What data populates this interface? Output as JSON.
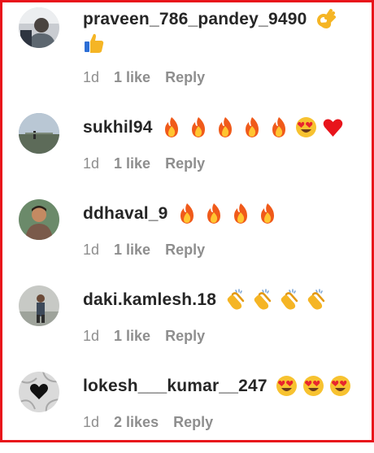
{
  "comments": [
    {
      "username": "praveen_786_pandey_9490",
      "emojis": [
        "ok-hand-icon",
        "thumbs-up-icon"
      ],
      "time": "1d",
      "likes": "1 like",
      "reply": "Reply"
    },
    {
      "username": "sukhil94",
      "emojis": [
        "fire-icon",
        "fire-icon",
        "fire-icon",
        "fire-icon",
        "fire-icon",
        "heart-eyes-icon",
        "red-heart-icon"
      ],
      "time": "1d",
      "likes": "1 like",
      "reply": "Reply"
    },
    {
      "username": "ddhaval_9",
      "emojis": [
        "fire-icon",
        "fire-icon",
        "fire-icon",
        "fire-icon"
      ],
      "time": "1d",
      "likes": "1 like",
      "reply": "Reply"
    },
    {
      "username": "daki.kamlesh.18",
      "emojis": [
        "clapping-hands-icon",
        "clapping-hands-icon",
        "clapping-hands-icon",
        "clapping-hands-icon"
      ],
      "time": "1d",
      "likes": "1 like",
      "reply": "Reply"
    },
    {
      "username": "lokesh___kumar__247",
      "emojis": [
        "heart-eyes-icon",
        "heart-eyes-icon",
        "heart-eyes-icon"
      ],
      "time": "1d",
      "likes": "2 likes",
      "reply": "Reply"
    }
  ],
  "colors": {
    "border": "#e8141b",
    "username": "#262626",
    "meta": "#8e8e8e"
  }
}
